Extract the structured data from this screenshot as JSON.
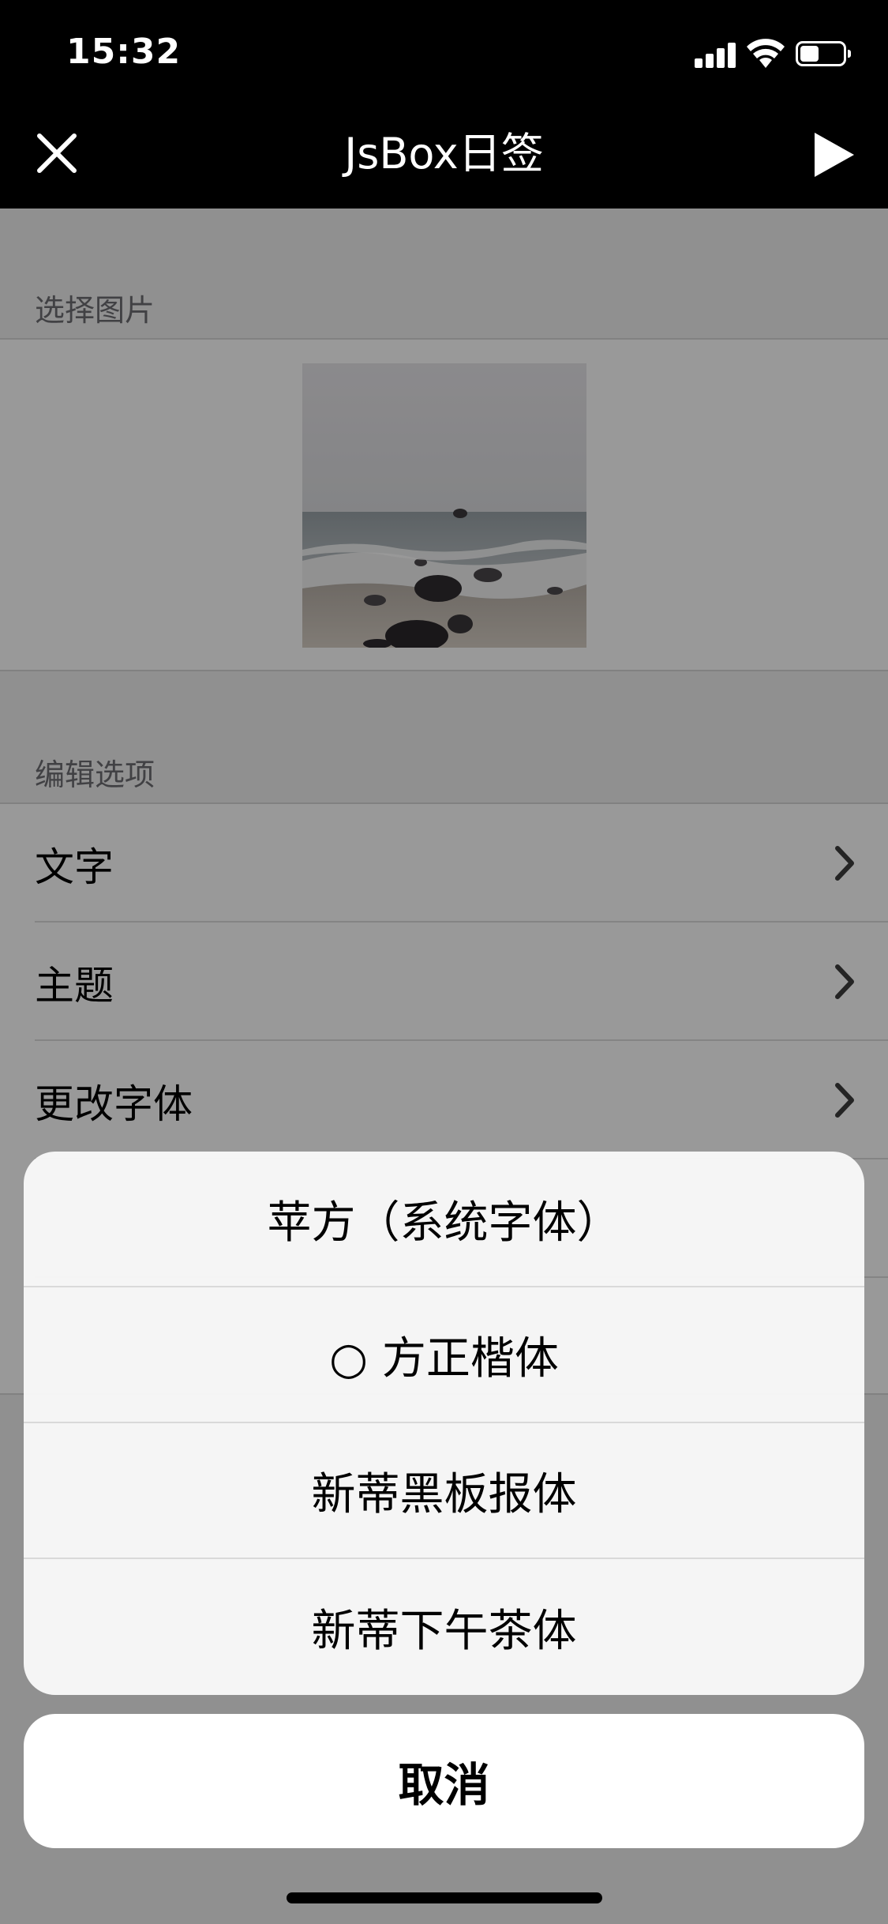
{
  "status_bar": {
    "time": "15:32",
    "battery_level": 0.45
  },
  "nav": {
    "title": "JsBox日签",
    "close_icon": "close-icon",
    "play_icon": "play-icon"
  },
  "sections": {
    "image_header": "选择图片",
    "edit_header": "编辑选项"
  },
  "edit_options": [
    {
      "label": "文字"
    },
    {
      "label": "主题"
    },
    {
      "label": "更改字体"
    }
  ],
  "action_sheet": {
    "items": [
      {
        "label": "苹方（系统字体）"
      },
      {
        "label": "○ 方正楷体"
      },
      {
        "label": "新蒂黑板报体"
      },
      {
        "label": "新蒂下午茶体"
      }
    ],
    "cancel_label": "取消"
  },
  "colors": {
    "nav_background": "#000000",
    "sheet_background": "#f8f8f8",
    "dim_overlay": "rgba(0,0,0,0.40)"
  }
}
